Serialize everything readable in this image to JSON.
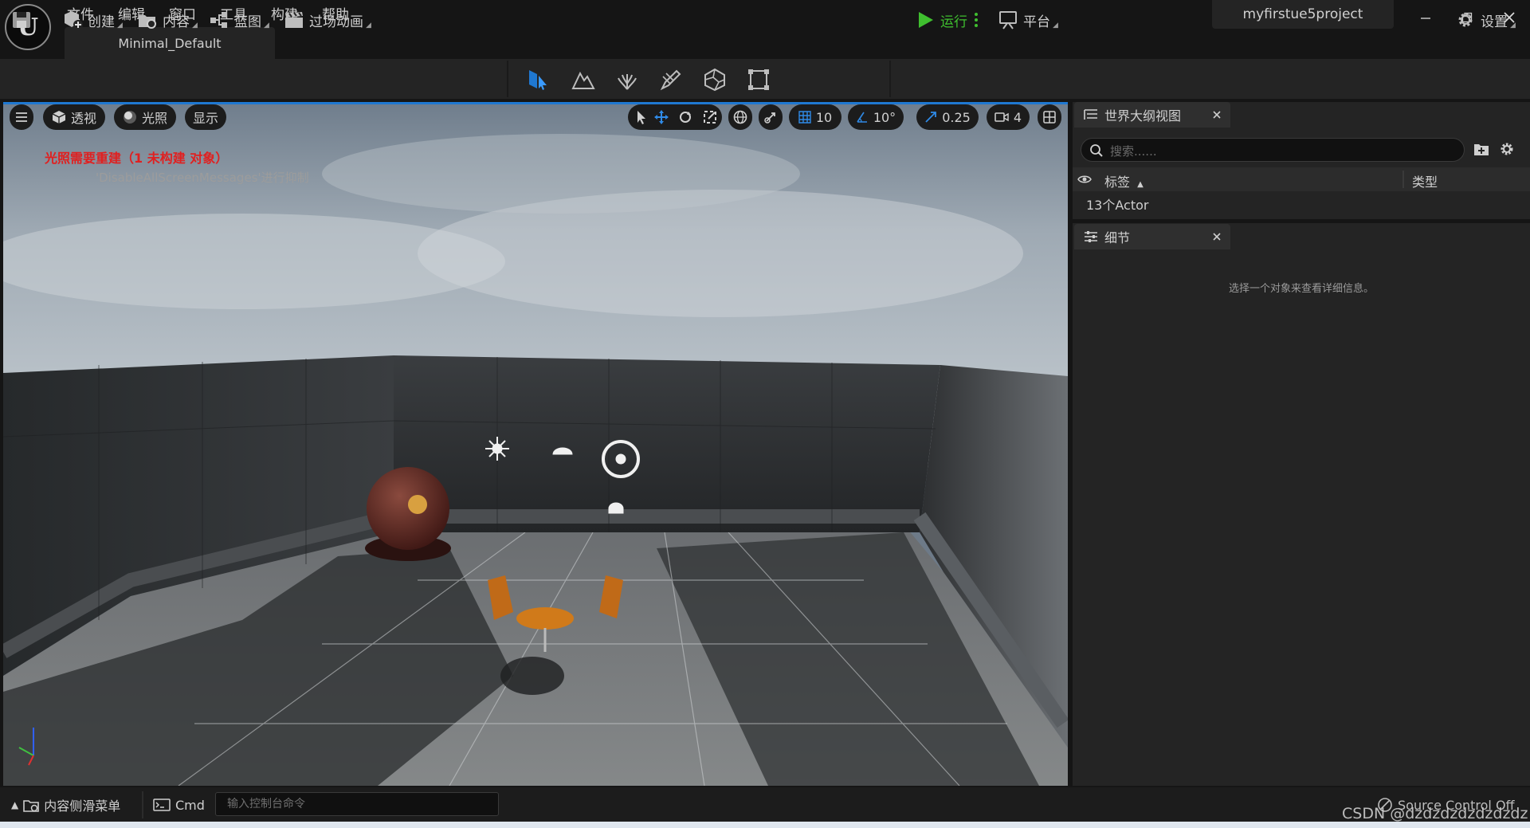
{
  "app": {
    "logo_letter": "U",
    "project_name": "myfirstue5project",
    "level_tab": "Minimal_Default"
  },
  "menu": {
    "file": "文件",
    "edit": "编辑",
    "window": "窗口",
    "tools": "工具",
    "build": "构建",
    "help": "帮助"
  },
  "toolbar": {
    "create": "创建",
    "content": "内容",
    "blueprint": "蓝图",
    "cinematics": "过场动画",
    "play": "运行",
    "platforms": "平台",
    "settings": "设置"
  },
  "modes": [
    "selection-mode-icon",
    "landscape-mode-icon",
    "foliage-mode-icon",
    "mesh-paint-mode-icon",
    "fracture-mode-icon",
    "brush-edit-mode-icon"
  ],
  "viewport": {
    "perspective": "透视",
    "lighting": "光照",
    "show": "显示",
    "grid_snap": "10",
    "rotation_snap": "10°",
    "scale_snap": "0.25",
    "camera_speed": "4",
    "warning": "光照需要重建（1 未构建 对象）",
    "suppress_note": "'DisableAllScreenMessages'进行抑制"
  },
  "outliner": {
    "tab": "世界大纲视图",
    "search_placeholder": "搜索......",
    "col_label": "标签",
    "col_type": "类型",
    "count": "13个Actor"
  },
  "details": {
    "tab": "细节",
    "empty": "选择一个对象来查看详细信息。"
  },
  "bottom": {
    "content_drawer": "内容侧滑菜单",
    "cmd": "Cmd",
    "cmd_placeholder": "输入控制台命令",
    "source_control": "Source Control Off",
    "watermark": "CSDN @dzdzdzdzdzdzdz"
  },
  "colors": {
    "accent_blue": "#1f78d1",
    "play_green": "#3fbf2f",
    "warning_red": "#e02020",
    "panel_bg": "#242424",
    "title_bg": "#151515"
  }
}
